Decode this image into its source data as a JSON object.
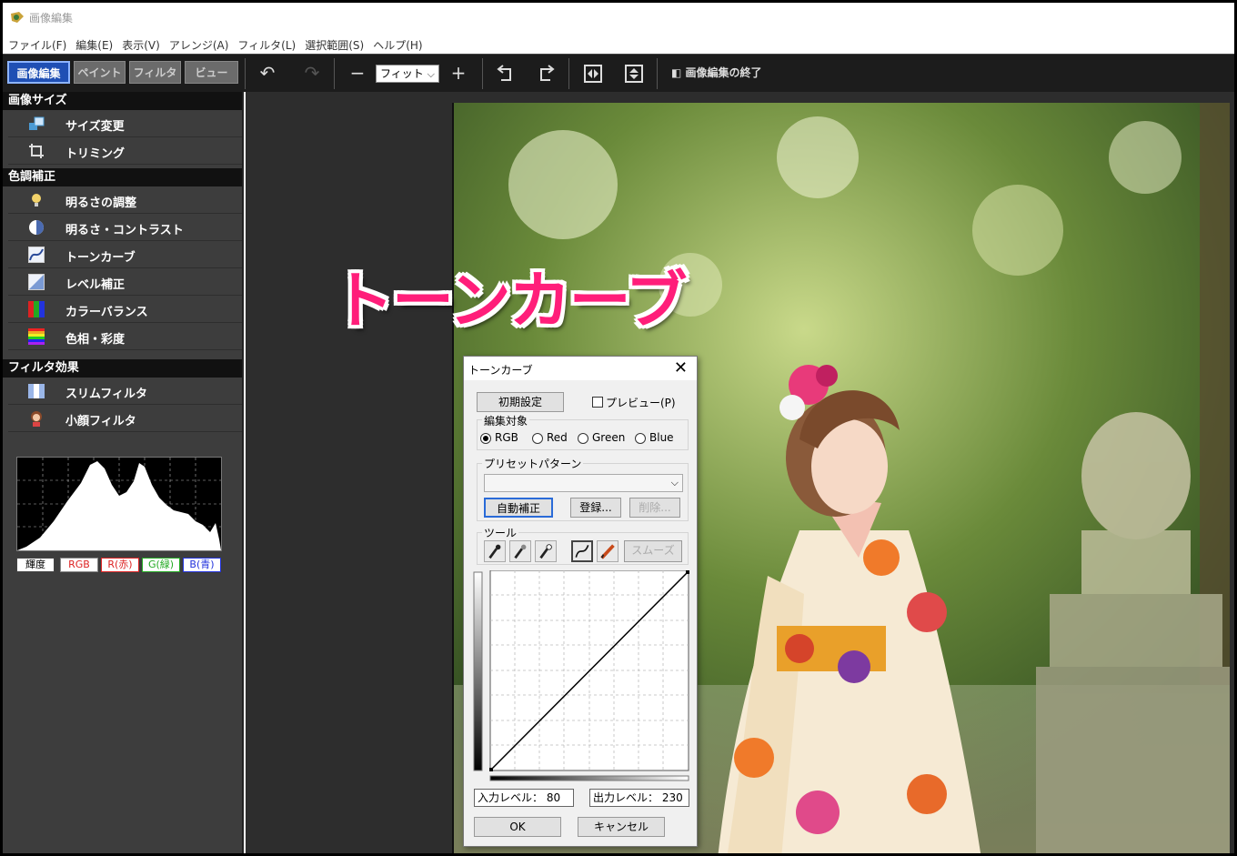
{
  "window": {
    "title": "画像編集"
  },
  "menu": [
    "ファイル(F)",
    "編集(E)",
    "表示(V)",
    "アレンジ(A)",
    "フィルタ(L)",
    "選択範囲(S)",
    "ヘルプ(H)"
  ],
  "mode_tabs": [
    "画像編集",
    "ペイント",
    "フィルタ",
    "ビュー"
  ],
  "toolbar": {
    "zoom_value": "フィット",
    "end_label": "画像編集の終了"
  },
  "sidebar": {
    "sections": [
      {
        "title": "画像サイズ",
        "items": [
          "サイズ変更",
          "トリミング"
        ]
      },
      {
        "title": "色調補正",
        "items": [
          "明るさの調整",
          "明るさ・コントラスト",
          "トーンカーブ",
          "レベル補正",
          "カラーバランス",
          "色相・彩度"
        ]
      },
      {
        "title": "フィルタ効果",
        "items": [
          "スリムフィルタ",
          "小顔フィルタ"
        ]
      }
    ],
    "histogram_buttons": [
      "輝度",
      "RGB",
      "R(赤)",
      "G(緑)",
      "B(青)"
    ]
  },
  "overlay_title": "トーンカーブ",
  "dialog": {
    "title": "トーンカーブ",
    "reset_btn": "初期設定",
    "preview_label": "プレビュー(P)",
    "target_label": "編集対象",
    "channels": [
      "RGB",
      "Red",
      "Green",
      "Blue"
    ],
    "selected_channel": "RGB",
    "preset_label": "プリセットパターン",
    "preset_value": "",
    "auto_btn": "自動補正",
    "register_btn": "登録...",
    "delete_btn": "削除...",
    "tool_label": "ツール",
    "smooth_btn": "スムーズ",
    "input_level": "入力レベル： 80",
    "output_level": "出力レベル： 230",
    "ok_btn": "OK",
    "cancel_btn": "キャンセル"
  },
  "colors": {
    "accent": "#1f4fb4",
    "overlay_text": "#ff1e7a",
    "panel": "#3d3d3d"
  }
}
